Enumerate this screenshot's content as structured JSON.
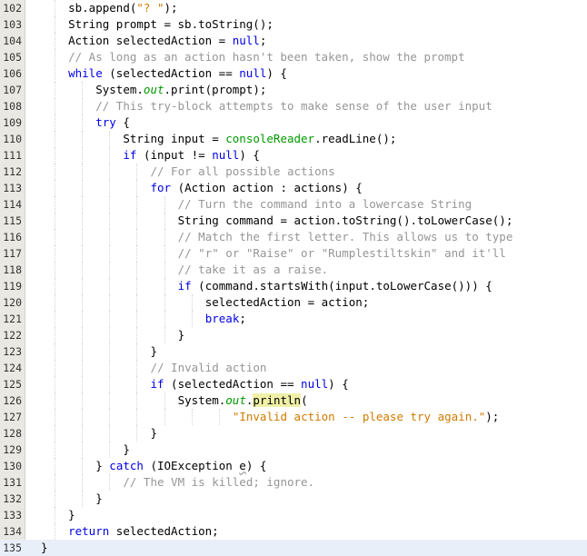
{
  "editor": {
    "current_line": 135,
    "lines": [
      {
        "n": "102",
        "indent": 2,
        "t": [
          [
            "p",
            "sb.append("
          ],
          [
            "s",
            "\"? \""
          ],
          [
            "p",
            ");"
          ]
        ]
      },
      {
        "n": "103",
        "indent": 2,
        "t": [
          [
            "p",
            "String prompt = sb.toString();"
          ]
        ]
      },
      {
        "n": "104",
        "indent": 2,
        "t": [
          [
            "p",
            "Action selectedAction = "
          ],
          [
            "k",
            "null"
          ],
          [
            "p",
            ";"
          ]
        ]
      },
      {
        "n": "105",
        "indent": 2,
        "t": [
          [
            "c",
            "// As long as an action hasn't been taken, show the prompt"
          ]
        ]
      },
      {
        "n": "106",
        "indent": 2,
        "t": [
          [
            "k",
            "while"
          ],
          [
            "p",
            " (selectedAction == "
          ],
          [
            "k",
            "null"
          ],
          [
            "p",
            ") {"
          ]
        ]
      },
      {
        "n": "107",
        "indent": 3,
        "t": [
          [
            "p",
            "System."
          ],
          [
            "f",
            "out"
          ],
          [
            "p",
            ".print(prompt);"
          ]
        ]
      },
      {
        "n": "108",
        "indent": 3,
        "t": [
          [
            "c",
            "// This try-block attempts to make sense of the user input"
          ]
        ]
      },
      {
        "n": "109",
        "indent": 3,
        "t": [
          [
            "k",
            "try"
          ],
          [
            "p",
            " {"
          ]
        ]
      },
      {
        "n": "110",
        "indent": 4,
        "t": [
          [
            "p",
            "String input = "
          ],
          [
            "m",
            "consoleReader"
          ],
          [
            "p",
            ".readLine();"
          ]
        ]
      },
      {
        "n": "111",
        "indent": 4,
        "t": [
          [
            "k",
            "if"
          ],
          [
            "p",
            " (input != "
          ],
          [
            "k",
            "null"
          ],
          [
            "p",
            ") {"
          ]
        ]
      },
      {
        "n": "112",
        "indent": 5,
        "t": [
          [
            "c",
            "// For all possible actions"
          ]
        ]
      },
      {
        "n": "113",
        "indent": 5,
        "t": [
          [
            "k",
            "for"
          ],
          [
            "p",
            " (Action action : actions) {"
          ]
        ]
      },
      {
        "n": "114",
        "indent": 6,
        "t": [
          [
            "c",
            "// Turn the command into a lowercase String"
          ]
        ]
      },
      {
        "n": "115",
        "indent": 6,
        "t": [
          [
            "p",
            "String command = action.toString().toLowerCase();"
          ]
        ]
      },
      {
        "n": "116",
        "indent": 6,
        "t": [
          [
            "c",
            "// Match the first letter. This allows us to type"
          ]
        ]
      },
      {
        "n": "117",
        "indent": 6,
        "t": [
          [
            "c",
            "// \"r\" or \"Raise\" or \"Rumplestiltskin\" and it'll"
          ]
        ]
      },
      {
        "n": "118",
        "indent": 6,
        "t": [
          [
            "c",
            "// take it as a raise."
          ]
        ]
      },
      {
        "n": "119",
        "indent": 6,
        "t": [
          [
            "k",
            "if"
          ],
          [
            "p",
            " (command.startsWith(input.toLowerCase())) {"
          ]
        ]
      },
      {
        "n": "120",
        "indent": 7,
        "t": [
          [
            "p",
            "selectedAction = action;"
          ]
        ]
      },
      {
        "n": "121",
        "indent": 7,
        "t": [
          [
            "k",
            "break"
          ],
          [
            "p",
            ";"
          ]
        ]
      },
      {
        "n": "122",
        "indent": 6,
        "t": [
          [
            "p",
            "}"
          ]
        ]
      },
      {
        "n": "123",
        "indent": 5,
        "t": [
          [
            "p",
            "}"
          ]
        ]
      },
      {
        "n": "124",
        "indent": 5,
        "t": [
          [
            "c",
            "// Invalid action"
          ]
        ]
      },
      {
        "n": "125",
        "indent": 5,
        "t": [
          [
            "k",
            "if"
          ],
          [
            "p",
            " (selectedAction == "
          ],
          [
            "k",
            "null"
          ],
          [
            "p",
            ") {"
          ]
        ]
      },
      {
        "n": "126",
        "indent": 6,
        "t": [
          [
            "p",
            "System."
          ],
          [
            "f",
            "out"
          ],
          [
            "p",
            "."
          ],
          [
            "h",
            "println"
          ],
          [
            "p",
            "("
          ]
        ]
      },
      {
        "n": "127",
        "indent": 8,
        "t": [
          [
            "s",
            "\"Invalid action -- please try again.\""
          ],
          [
            "p",
            ");"
          ]
        ]
      },
      {
        "n": "128",
        "indent": 5,
        "t": [
          [
            "p",
            "}"
          ]
        ]
      },
      {
        "n": "129",
        "indent": 4,
        "t": [
          [
            "p",
            "}"
          ]
        ]
      },
      {
        "n": "130",
        "indent": 3,
        "t": [
          [
            "p",
            "} "
          ],
          [
            "k",
            "catch"
          ],
          [
            "p",
            " (IOException "
          ],
          [
            "u",
            "e"
          ],
          [
            "p",
            ") {"
          ]
        ]
      },
      {
        "n": "131",
        "indent": 4,
        "t": [
          [
            "c",
            "// The VM is killed; ignore."
          ]
        ]
      },
      {
        "n": "132",
        "indent": 3,
        "t": [
          [
            "p",
            "}"
          ]
        ]
      },
      {
        "n": "133",
        "indent": 2,
        "t": [
          [
            "p",
            "}"
          ]
        ]
      },
      {
        "n": "134",
        "indent": 2,
        "t": [
          [
            "k",
            "return"
          ],
          [
            "p",
            " selectedAction;"
          ]
        ]
      },
      {
        "n": "135",
        "indent": 1,
        "t": [
          [
            "p",
            "}"
          ]
        ]
      }
    ]
  }
}
